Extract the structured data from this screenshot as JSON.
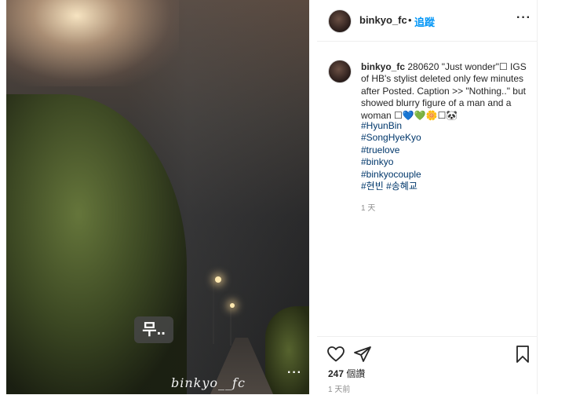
{
  "post": {
    "username": "binkyo_fc",
    "separator": "•",
    "follow_label": "追蹤",
    "more_label": "···",
    "caption": {
      "username": "binkyo_fc",
      "text": "280620 \"Just wonder\"☐ IGS of HB's stylist deleted only few minutes after Posted. Caption >> \"Nothing..\" but showed blurry figure of a man and a woman ☐💙💚🌼☐🐼"
    },
    "hashtags": [
      "#HyunBin",
      "#SongHyeKyo",
      "#truelove",
      "#binkyo",
      "#binkyocouple",
      "#현빈 #송혜교"
    ],
    "caption_time": "1 天",
    "likes_count": "247",
    "likes_label": "個讚",
    "post_time": "1 天前"
  },
  "photo": {
    "sticker_text": "무..",
    "watermark": "binkyo__fc",
    "more_label": "···"
  },
  "icons": {
    "like": "heart-icon",
    "share": "send-icon",
    "save": "bookmark-icon",
    "more": "more-options-icon"
  },
  "colors": {
    "link": "#0095f6",
    "hashtag": "#00376b",
    "muted": "#8e8e8e",
    "text": "#262626"
  }
}
